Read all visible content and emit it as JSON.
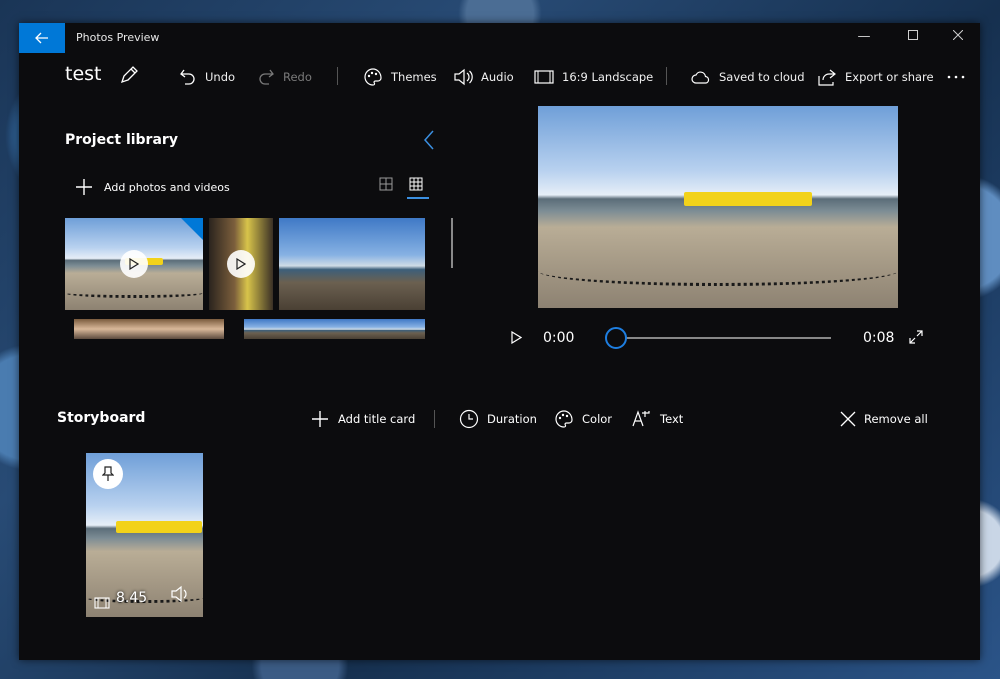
{
  "app": {
    "title": "Photos Preview"
  },
  "toolbar": {
    "project_name": "test",
    "undo": "Undo",
    "redo": "Redo",
    "themes": "Themes",
    "audio": "Audio",
    "aspect": "16:9 Landscape",
    "cloud": "Saved to cloud",
    "export": "Export or share"
  },
  "library": {
    "title": "Project library",
    "add_label": "Add photos and videos"
  },
  "player": {
    "current_time": "0:00",
    "end_time": "0:08",
    "progress": 0
  },
  "storyboard": {
    "title": "Storyboard",
    "add_title_card": "Add title card",
    "duration": "Duration",
    "color": "Color",
    "text": "Text",
    "remove_all": "Remove all",
    "clips": [
      {
        "duration": "8.45"
      }
    ]
  },
  "colors": {
    "accent": "#0078d7",
    "background": "#0c0c0e"
  }
}
